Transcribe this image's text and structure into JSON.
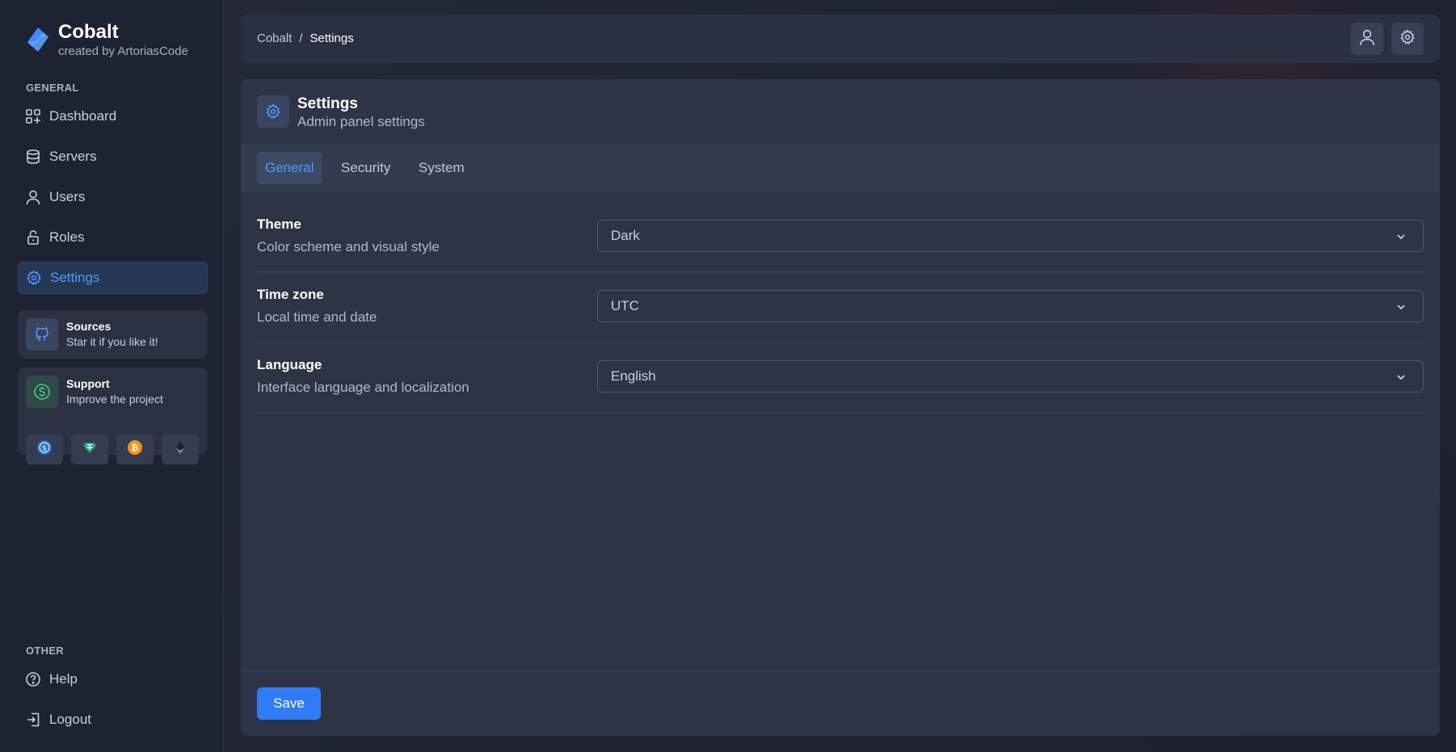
{
  "brand": {
    "name": "Cobalt",
    "subtitle": "created by ArtoriasCode"
  },
  "sidebar": {
    "general_label": "GENERAL",
    "items": [
      {
        "label": "Dashboard",
        "icon": "dashboard-icon"
      },
      {
        "label": "Servers",
        "icon": "database-icon"
      },
      {
        "label": "Users",
        "icon": "user-icon"
      },
      {
        "label": "Roles",
        "icon": "lock-icon"
      },
      {
        "label": "Settings",
        "icon": "gear-icon",
        "active": true
      }
    ],
    "sources_card": {
      "title": "Sources",
      "subtitle": "Star it if you like it!",
      "icon": "github-icon"
    },
    "support_card": {
      "title": "Support",
      "subtitle": "Improve the project",
      "icon": "dollar-icon",
      "coins": [
        "usdc-icon",
        "tether-icon",
        "bitcoin-icon",
        "ethereum-icon"
      ]
    },
    "other_label": "OTHER",
    "bottom_items": [
      {
        "label": "Help",
        "icon": "help-icon"
      },
      {
        "label": "Logout",
        "icon": "logout-icon"
      }
    ]
  },
  "topbar": {
    "breadcrumb": {
      "root": "Cobalt",
      "separator": "/",
      "current": "Settings"
    },
    "buttons": [
      "user-icon",
      "gear-icon"
    ]
  },
  "panel": {
    "title": "Settings",
    "subtitle": "Admin panel settings",
    "tabs": [
      {
        "label": "General",
        "active": true
      },
      {
        "label": "Security"
      },
      {
        "label": "System"
      }
    ],
    "settings": [
      {
        "label": "Theme",
        "description": "Color scheme and visual style",
        "value": "Dark"
      },
      {
        "label": "Time zone",
        "description": "Local time and date",
        "value": "UTC"
      },
      {
        "label": "Language",
        "description": "Interface language and localization",
        "value": "English"
      }
    ],
    "save_label": "Save"
  },
  "colors": {
    "accent": "#4d9bff",
    "primary_button": "#2f7cf6",
    "background": "#1f2433",
    "panel": "#2e3446"
  }
}
